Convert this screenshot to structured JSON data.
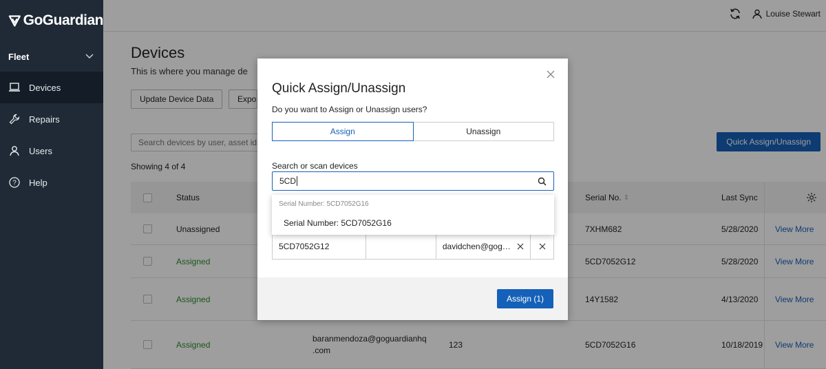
{
  "brand": {
    "name": "GoGuardian"
  },
  "sidebar": {
    "section": "Fleet",
    "items": [
      {
        "label": "Devices",
        "icon": "laptop-icon"
      },
      {
        "label": "Repairs",
        "icon": "wrench-icon"
      },
      {
        "label": "Users",
        "icon": "user-icon"
      },
      {
        "label": "Help",
        "icon": "help-icon"
      }
    ]
  },
  "header": {
    "user_name": "Louise Stewart"
  },
  "page": {
    "title": "Devices",
    "subtitle": "This is where you manage de",
    "buttons": {
      "update": "Update Device Data",
      "export": "Expo"
    },
    "search_placeholder": "Search devices by user, asset id",
    "quick_assign": "Quick Assign/Unassign",
    "showing": "Showing 4 of 4"
  },
  "table": {
    "headers": {
      "status": "Status",
      "serial": "Serial No. ",
      "serial_sort": "⇕",
      "last_sync": "Last Sync"
    },
    "rows": [
      {
        "status": "Unassigned",
        "user": "",
        "asset": "",
        "serial": "7XHM682",
        "last_sync": "5/28/2020",
        "action": "View More"
      },
      {
        "status": "Assigned",
        "user": "",
        "asset": "",
        "serial": "5CD7052G12",
        "last_sync": "5/28/2020",
        "action": "View More"
      },
      {
        "status": "Assigned",
        "user": "",
        "asset": "",
        "serial": "14Y1582",
        "last_sync": "4/13/2020",
        "action": "View More"
      },
      {
        "status": "Assigned",
        "user": "baranmendoza@goguardianhq.com",
        "user_line1": "baranmendoza@goguardianhq",
        "user_line2": ".com",
        "asset": "123",
        "serial": "5CD7052G16",
        "last_sync": "10/18/2019",
        "action": "View More"
      }
    ]
  },
  "modal": {
    "title": "Quick Assign/Unassign",
    "question": "Do you want to Assign or Unassign users?",
    "tabs": {
      "assign": "Assign",
      "unassign": "Unassign"
    },
    "search_label": "Search or scan devices",
    "search_value": "5CD",
    "dropdown_hint": "Serial Number: 5CD7052G16",
    "dropdown_item": "Serial Number: 5CD7052G16",
    "assign_row": {
      "serial": "5CD7052G12",
      "asset": "",
      "user": "davidchen@gog…"
    },
    "submit": "Assign (1)"
  },
  "colors": {
    "sidebar": "#1f2a36",
    "primary": "#1560b8",
    "assigned": "#2e8a2e"
  }
}
